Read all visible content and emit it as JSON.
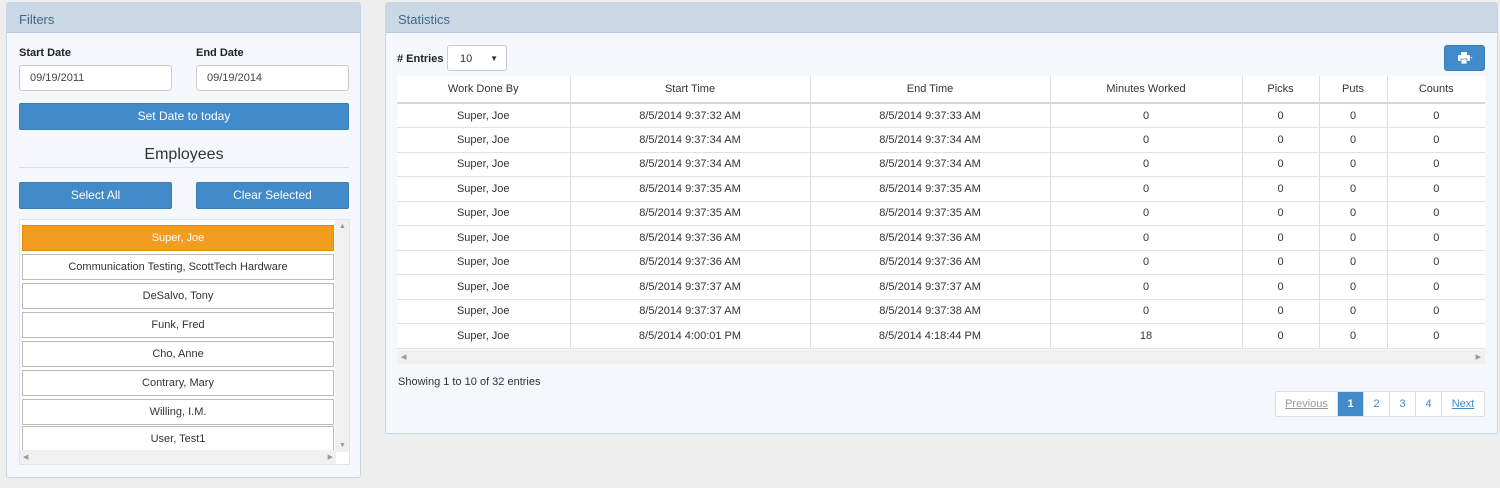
{
  "filters": {
    "heading": "Filters",
    "start_date_label": "Start Date",
    "start_date_value": "09/19/2011",
    "end_date_label": "End Date",
    "end_date_value": "09/19/2014",
    "set_today_label": "Set Date to today",
    "employees_title": "Employees",
    "select_all_label": "Select All",
    "clear_selected_label": "Clear Selected",
    "employees": [
      {
        "name": "Super, Joe",
        "selected": true
      },
      {
        "name": "Communication Testing, ScottTech Hardware",
        "selected": false
      },
      {
        "name": "DeSalvo, Tony",
        "selected": false
      },
      {
        "name": "Funk, Fred",
        "selected": false
      },
      {
        "name": "Cho, Anne",
        "selected": false
      },
      {
        "name": "Contrary, Mary",
        "selected": false
      },
      {
        "name": "Willing, I.M.",
        "selected": false
      },
      {
        "name": "User, Test1",
        "selected": false
      }
    ]
  },
  "statistics": {
    "heading": "Statistics",
    "entries_label": "# Entries",
    "entries_value": "10",
    "print_icon": "print-icon",
    "columns": [
      "Work Done By",
      "Start Time",
      "End Time",
      "Minutes Worked",
      "Picks",
      "Puts",
      "Counts"
    ],
    "rows": [
      [
        "Super, Joe",
        "8/5/2014 9:37:32 AM",
        "8/5/2014 9:37:33 AM",
        "0",
        "0",
        "0",
        "0"
      ],
      [
        "Super, Joe",
        "8/5/2014 9:37:34 AM",
        "8/5/2014 9:37:34 AM",
        "0",
        "0",
        "0",
        "0"
      ],
      [
        "Super, Joe",
        "8/5/2014 9:37:34 AM",
        "8/5/2014 9:37:34 AM",
        "0",
        "0",
        "0",
        "0"
      ],
      [
        "Super, Joe",
        "8/5/2014 9:37:35 AM",
        "8/5/2014 9:37:35 AM",
        "0",
        "0",
        "0",
        "0"
      ],
      [
        "Super, Joe",
        "8/5/2014 9:37:35 AM",
        "8/5/2014 9:37:35 AM",
        "0",
        "0",
        "0",
        "0"
      ],
      [
        "Super, Joe",
        "8/5/2014 9:37:36 AM",
        "8/5/2014 9:37:36 AM",
        "0",
        "0",
        "0",
        "0"
      ],
      [
        "Super, Joe",
        "8/5/2014 9:37:36 AM",
        "8/5/2014 9:37:36 AM",
        "0",
        "0",
        "0",
        "0"
      ],
      [
        "Super, Joe",
        "8/5/2014 9:37:37 AM",
        "8/5/2014 9:37:37 AM",
        "0",
        "0",
        "0",
        "0"
      ],
      [
        "Super, Joe",
        "8/5/2014 9:37:37 AM",
        "8/5/2014 9:37:38 AM",
        "0",
        "0",
        "0",
        "0"
      ],
      [
        "Super, Joe",
        "8/5/2014 4:00:01 PM",
        "8/5/2014 4:18:44 PM",
        "18",
        "0",
        "0",
        "0"
      ]
    ],
    "showing_text": "Showing 1 to 10 of 32 entries",
    "pagination": {
      "previous": "Previous",
      "pages": [
        "1",
        "2",
        "3",
        "4"
      ],
      "active_page": "1",
      "next": "Next"
    }
  },
  "colors": {
    "accent_blue": "#428bca",
    "selected_orange": "#f39c1f",
    "panel_heading": "#c9d8e4"
  }
}
